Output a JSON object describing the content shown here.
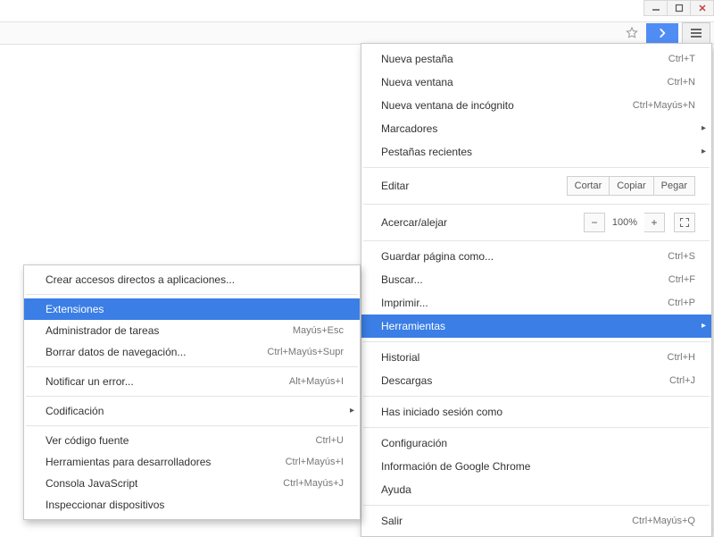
{
  "main_menu": {
    "items": [
      {
        "label": "Nueva pestaña",
        "shortcut": "Ctrl+T"
      },
      {
        "label": "Nueva ventana",
        "shortcut": "Ctrl+N"
      },
      {
        "label": "Nueva ventana de incógnito",
        "shortcut": "Ctrl+Mayús+N"
      },
      {
        "label": "Marcadores",
        "submenu": true
      },
      {
        "label": "Pestañas recientes",
        "submenu": true
      }
    ],
    "edit_label": "Editar",
    "edit_buttons": {
      "cut": "Cortar",
      "copy": "Copiar",
      "paste": "Pegar"
    },
    "zoom_label": "Acercar/alejar",
    "zoom_value": "100%",
    "group2": [
      {
        "label": "Guardar página como...",
        "shortcut": "Ctrl+S"
      },
      {
        "label": "Buscar...",
        "shortcut": "Ctrl+F"
      },
      {
        "label": "Imprimir...",
        "shortcut": "Ctrl+P"
      }
    ],
    "tools_label": "Herramientas",
    "group3": [
      {
        "label": "Historial",
        "shortcut": "Ctrl+H"
      },
      {
        "label": "Descargas",
        "shortcut": "Ctrl+J"
      }
    ],
    "signed_label": "Has iniciado sesión como",
    "group4": [
      {
        "label": "Configuración"
      },
      {
        "label": "Información de Google Chrome"
      },
      {
        "label": "Ayuda"
      }
    ],
    "exit": {
      "label": "Salir",
      "shortcut": "Ctrl+Mayús+Q"
    }
  },
  "sub_menu": {
    "items": [
      {
        "label": "Crear accesos directos a aplicaciones..."
      },
      null,
      {
        "label": "Extensiones",
        "highlight": true
      },
      {
        "label": "Administrador de tareas",
        "shortcut": "Mayús+Esc"
      },
      {
        "label": "Borrar datos de navegación...",
        "shortcut": "Ctrl+Mayús+Supr"
      },
      null,
      {
        "label": "Notificar un error...",
        "shortcut": "Alt+Mayús+I"
      },
      null,
      {
        "label": "Codificación",
        "submenu": true
      },
      null,
      {
        "label": "Ver código fuente",
        "shortcut": "Ctrl+U"
      },
      {
        "label": "Herramientas para desarrolladores",
        "shortcut": "Ctrl+Mayús+I"
      },
      {
        "label": "Consola JavaScript",
        "shortcut": "Ctrl+Mayús+J"
      },
      {
        "label": "Inspeccionar dispositivos"
      }
    ]
  }
}
